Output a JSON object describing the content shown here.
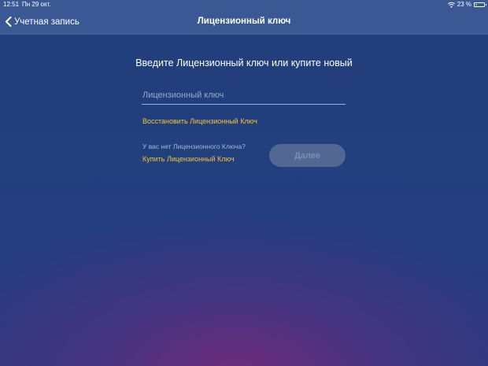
{
  "status_bar": {
    "time": "12:51",
    "date": "Пн 29 окт.",
    "battery_percent": "23 %",
    "battery_level": 0.23,
    "icons": [
      "wifi-icon",
      "battery-icon"
    ]
  },
  "nav": {
    "back_label": "Учетная запись",
    "back_icon": "chevron-left-icon",
    "title": "Лицензионный ключ"
  },
  "main": {
    "heading": "Введите Лицензионный ключ или купите новый",
    "license_input": {
      "placeholder": "Лицензионный ключ",
      "value": ""
    },
    "restore_link": "Восстановить Лицензионный Ключ",
    "no_key_text": "У вас нет Лицензионного Ключа?",
    "buy_link": "Купить Лицензионный Ключ",
    "next_button": {
      "label": "Далее",
      "enabled": false
    }
  },
  "colors": {
    "bar_background": "#3a5893",
    "page_background": "#213f7b",
    "link_accent": "#f5c531",
    "button_disabled": "#526893"
  }
}
